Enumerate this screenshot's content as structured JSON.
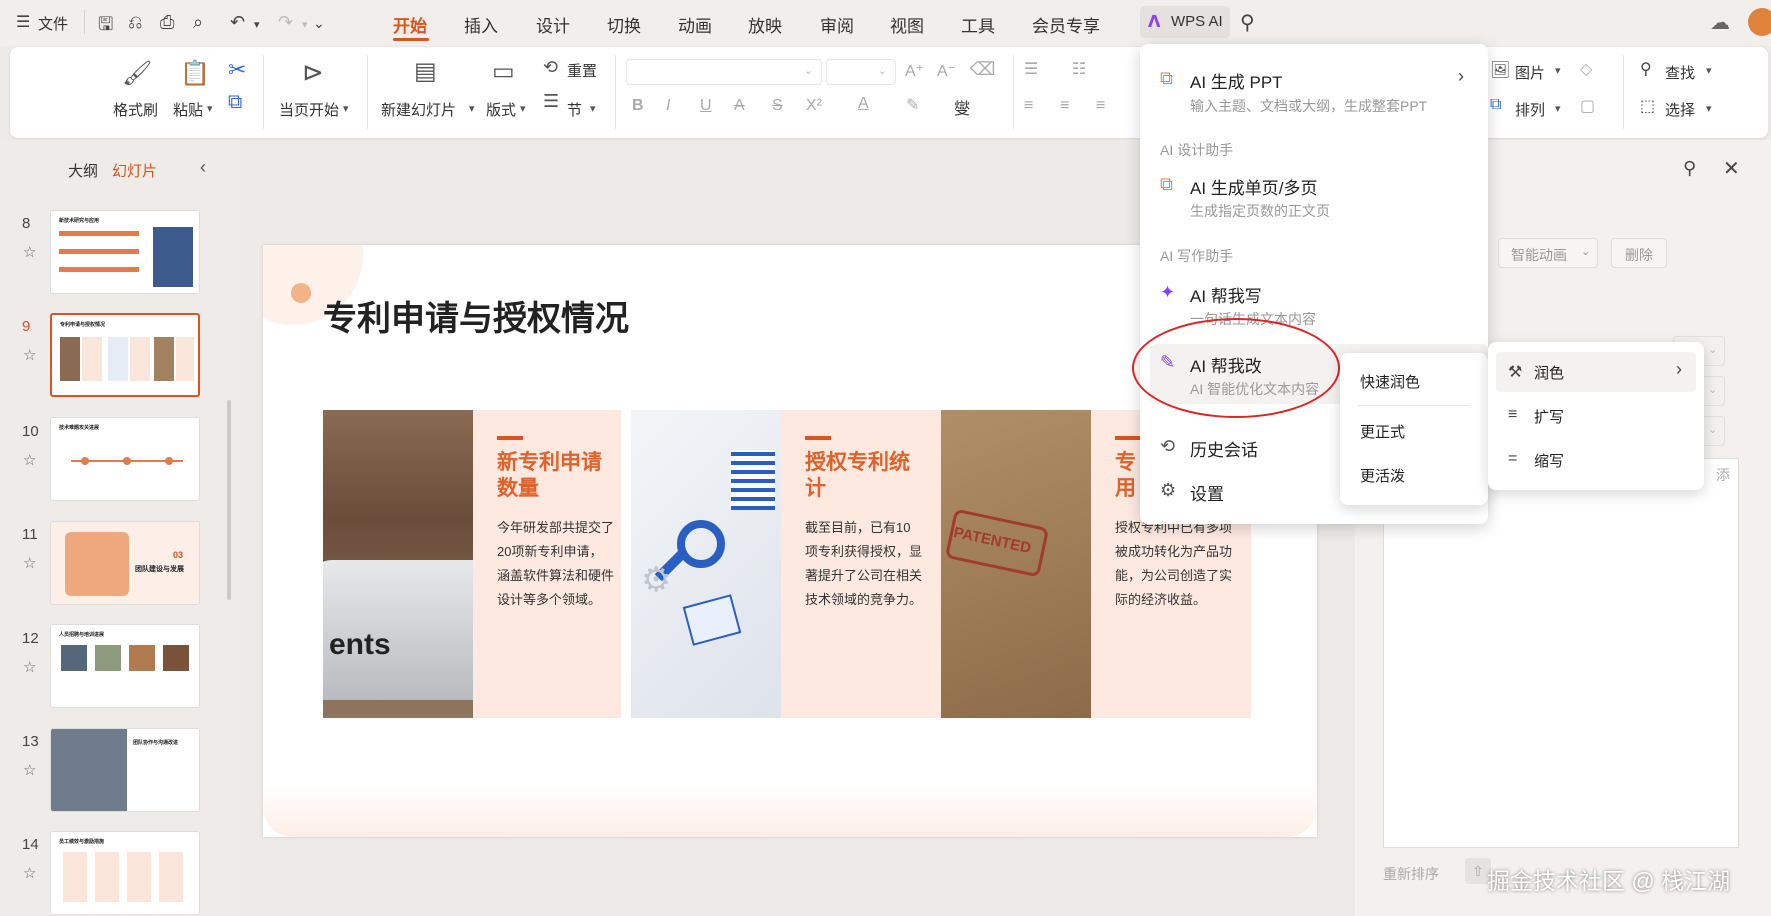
{
  "menubar": {
    "file_label": "文件",
    "tabs": [
      {
        "label": "开始",
        "active": true
      },
      {
        "label": "插入"
      },
      {
        "label": "设计"
      },
      {
        "label": "切换"
      },
      {
        "label": "动画"
      },
      {
        "label": "放映"
      },
      {
        "label": "审阅"
      },
      {
        "label": "视图"
      },
      {
        "label": "工具"
      },
      {
        "label": "会员专享"
      }
    ],
    "wps_ai_label": "WPS AI"
  },
  "ribbon": {
    "format_painter": "格式刷",
    "paste": "粘贴",
    "from_current": "当页开始",
    "new_slide": "新建幻灯片",
    "layout": "版式",
    "reset": "重置",
    "section": "节",
    "picture": "图片",
    "arrange": "排列",
    "find": "查找",
    "select": "选择"
  },
  "slidepanel": {
    "tab_outline": "大纲",
    "tab_slides": "幻灯片",
    "slides": [
      {
        "num": "8",
        "title": "新技术研究与应用"
      },
      {
        "num": "9",
        "title": "专利申请与授权情况",
        "selected": true
      },
      {
        "num": "10",
        "title": "技术难题攻关进展"
      },
      {
        "num": "11",
        "title": "团队建设与发展",
        "badge": "03"
      },
      {
        "num": "12",
        "title": "人员招聘与培训进展"
      },
      {
        "num": "13",
        "title": "团队协作与沟通改进"
      },
      {
        "num": "14",
        "title": "员工绩效与激励措施"
      }
    ]
  },
  "slide": {
    "title": "专利申请与授权情况",
    "card1_heading": "新专利申请数量",
    "card1_body": "今年研发部共提交了20项新专利申请，涵盖软件算法和硬件设计等多个领域。",
    "card2_heading": "授权专利统计",
    "card2_body": "截至目前，已有10项专利获得授权，显著提升了公司在相关技术领域的竞争力。",
    "card3_heading": "专用",
    "card3_body": "授权专利中已有多项被成功转化为产品功能，为公司创造了实际的经济收益。",
    "img1_text": "ents",
    "img3_text": "PATENTED"
  },
  "rightpane": {
    "smart_anim": "智能动画",
    "delete": "删除",
    "add_hint": "添",
    "reorder": "重新排序",
    "watermark": "掘金技术社区 @ 栈江湖"
  },
  "aimenu": {
    "gen_ppt_title": "AI 生成 PPT",
    "gen_ppt_sub": "输入主题、文档或大纲，生成整套PPT",
    "design_section": "AI 设计助手",
    "gen_page_title": "AI 生成单页/多页",
    "gen_page_sub": "生成指定页数的正文页",
    "write_section": "AI 写作助手",
    "write_title": "AI 帮我写",
    "write_sub": "一句话生成文本内容",
    "edit_title": "AI 帮我改",
    "edit_sub": "AI 智能优化文本内容",
    "history": "历史会话",
    "settings": "设置"
  },
  "submenu1": {
    "quick": "快速润色",
    "formal": "更正式",
    "lively": "更活泼"
  },
  "submenu2": {
    "polish": "润色",
    "expand": "扩写",
    "shorten": "缩写"
  },
  "colors": {
    "accent": "#d9541e",
    "annotation_red": "#e02424",
    "ai_purple": "#8a3ffc"
  }
}
